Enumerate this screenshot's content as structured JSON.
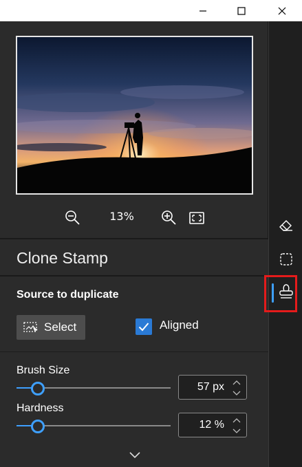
{
  "window": {
    "minimize_icon": "minimize-icon",
    "maximize_icon": "maximize-icon",
    "close_icon": "close-icon"
  },
  "preview": {
    "zoom_level": "13%",
    "zoom_out_icon": "zoom-out-icon",
    "zoom_in_icon": "zoom-in-icon",
    "fit_icon": "fit-to-window-icon"
  },
  "panel": {
    "title": "Clone Stamp",
    "source_title": "Source to duplicate",
    "select_label": "Select",
    "aligned_label": "Aligned",
    "aligned_checked": true
  },
  "brush_size": {
    "label": "Brush Size",
    "value": "57 px",
    "fraction": 0.14
  },
  "hardness": {
    "label": "Hardness",
    "value": "12 %",
    "fraction": 0.14
  },
  "toolbar": {
    "tools": [
      "eraser-icon",
      "selection-icon",
      "clone-stamp-icon"
    ],
    "active_tool": "clone-stamp-icon"
  },
  "colors": {
    "accent": "#3ea0ff",
    "checkbox": "#2a7ad5",
    "highlight": "#e51b1b"
  }
}
